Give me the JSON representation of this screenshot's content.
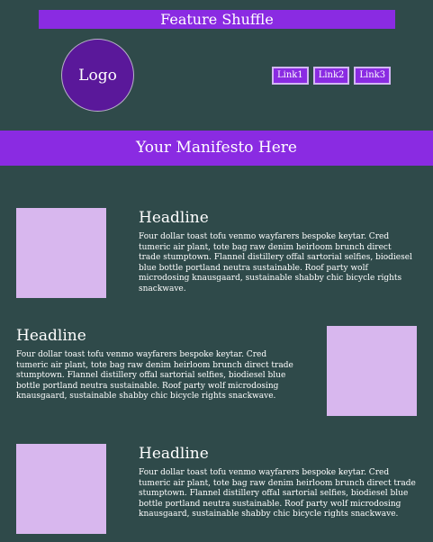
{
  "header": {
    "title": "Feature Shuffle",
    "logo_text": "Logo",
    "links": [
      "Link1",
      "Link2",
      "Link3"
    ]
  },
  "manifesto": "Your Manifesto Here",
  "features": [
    {
      "headline": "Headline",
      "body": "Four dollar toast tofu venmo wayfarers bespoke keytar. Cred tumeric air plant, tote bag raw denim heirloom brunch direct trade stumptown. Flannel distillery offal sartorial selfies, biodiesel blue bottle portland neutra sustainable. Roof party wolf microdosing knausgaard, sustainable shabby chic bicycle rights snackwave."
    },
    {
      "headline": "Headline",
      "body": "Four dollar toast tofu venmo wayfarers bespoke keytar. Cred tumeric air plant, tote bag raw denim heirloom brunch direct trade stumptown. Flannel distillery offal sartorial selfies, biodiesel blue bottle portland neutra sustainable. Roof party wolf microdosing knausgaard, sustainable shabby chic bicycle rights snackwave."
    },
    {
      "headline": "Headline",
      "body": "Four dollar toast tofu venmo wayfarers bespoke keytar. Cred tumeric air plant, tote bag raw denim heirloom brunch direct trade stumptown. Flannel distillery offal sartorial selfies, biodiesel blue bottle portland neutra sustainable. Roof party wolf microdosing knausgaard, sustainable shabby chic bicycle rights snackwave."
    }
  ],
  "colors": {
    "background": "#2f4a4a",
    "accent": "#8a2be2",
    "logo": "#5a189a",
    "image_placeholder": "#d8b7ee"
  }
}
